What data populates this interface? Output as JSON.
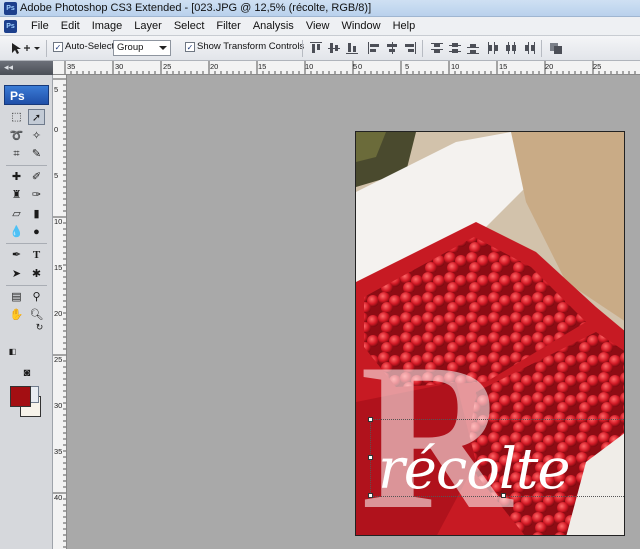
{
  "window": {
    "title": "Adobe Photoshop CS3 Extended - [023.JPG @ 12,5% (récolte, RGB/8)]",
    "app_icon": "Ps"
  },
  "menu": {
    "items": [
      "File",
      "Edit",
      "Image",
      "Layer",
      "Select",
      "Filter",
      "Analysis",
      "View",
      "Window",
      "Help"
    ]
  },
  "options": {
    "auto_select_label": "Auto-Select:",
    "auto_select_checked": true,
    "auto_select_value": "Group",
    "show_transform_label": "Show Transform Controls",
    "show_transform_checked": true
  },
  "tools_panel": {
    "collapse_glyph": "◂◂",
    "logo": "Ps",
    "foreground_color": "#a30e12",
    "background_color": "#f7f3ea"
  },
  "rulers": {
    "top_labels": [
      "35",
      "30",
      "25",
      "20",
      "15",
      "10",
      "5",
      "0",
      "5",
      "10",
      "15",
      "20",
      "25"
    ],
    "left_labels": [
      "5",
      "0",
      "5",
      "10",
      "15",
      "20",
      "25",
      "30",
      "35",
      "40"
    ]
  },
  "document": {
    "overlay_letter": "R",
    "overlay_text": "récolte"
  }
}
